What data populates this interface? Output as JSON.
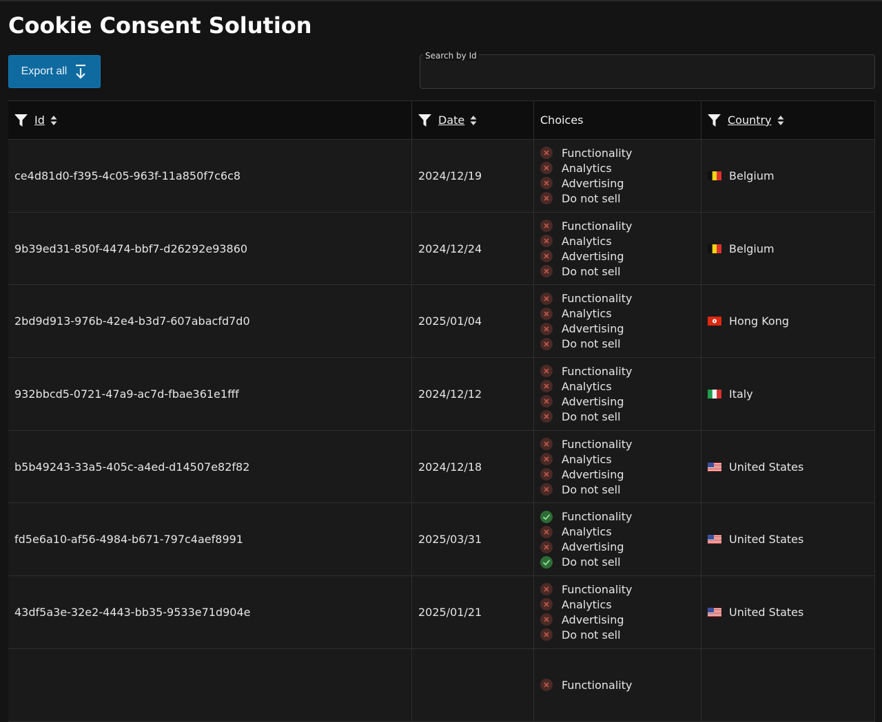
{
  "title": "Cookie Consent Solution",
  "toolbar": {
    "export_label": "Export all",
    "search_label": "Search by Id",
    "search_value": ""
  },
  "columns": {
    "id": "Id",
    "date": "Date",
    "choices": "Choices",
    "country": "Country"
  },
  "colors": {
    "accent": "#0f6aa0",
    "declined": "#4a2a26",
    "declined_mark": "#c0584d",
    "accepted": "#2e6b35",
    "accepted_mark": "#8fe09a"
  },
  "rows": [
    {
      "id": "ce4d81d0-f395-4c05-963f-11a850f7c6c8",
      "date": "2024/12/19",
      "country": "Belgium",
      "flag": "be",
      "choices": [
        {
          "label": "Functionality",
          "accepted": false
        },
        {
          "label": "Analytics",
          "accepted": false
        },
        {
          "label": "Advertising",
          "accepted": false
        },
        {
          "label": "Do not sell",
          "accepted": false
        }
      ]
    },
    {
      "id": "9b39ed31-850f-4474-bbf7-d26292e93860",
      "date": "2024/12/24",
      "country": "Belgium",
      "flag": "be",
      "choices": [
        {
          "label": "Functionality",
          "accepted": false
        },
        {
          "label": "Analytics",
          "accepted": false
        },
        {
          "label": "Advertising",
          "accepted": false
        },
        {
          "label": "Do not sell",
          "accepted": false
        }
      ]
    },
    {
      "id": "2bd9d913-976b-42e4-b3d7-607abacfd7d0",
      "date": "2025/01/04",
      "country": "Hong Kong",
      "flag": "hk",
      "choices": [
        {
          "label": "Functionality",
          "accepted": false
        },
        {
          "label": "Analytics",
          "accepted": false
        },
        {
          "label": "Advertising",
          "accepted": false
        },
        {
          "label": "Do not sell",
          "accepted": false
        }
      ]
    },
    {
      "id": "932bbcd5-0721-47a9-ac7d-fbae361e1fff",
      "date": "2024/12/12",
      "country": "Italy",
      "flag": "it",
      "choices": [
        {
          "label": "Functionality",
          "accepted": false
        },
        {
          "label": "Analytics",
          "accepted": false
        },
        {
          "label": "Advertising",
          "accepted": false
        },
        {
          "label": "Do not sell",
          "accepted": false
        }
      ]
    },
    {
      "id": "b5b49243-33a5-405c-a4ed-d14507e82f82",
      "date": "2024/12/18",
      "country": "United States",
      "flag": "us",
      "choices": [
        {
          "label": "Functionality",
          "accepted": false
        },
        {
          "label": "Analytics",
          "accepted": false
        },
        {
          "label": "Advertising",
          "accepted": false
        },
        {
          "label": "Do not sell",
          "accepted": false
        }
      ]
    },
    {
      "id": "fd5e6a10-af56-4984-b671-797c4aef8991",
      "date": "2025/03/31",
      "country": "United States",
      "flag": "us",
      "choices": [
        {
          "label": "Functionality",
          "accepted": true
        },
        {
          "label": "Analytics",
          "accepted": false
        },
        {
          "label": "Advertising",
          "accepted": false
        },
        {
          "label": "Do not sell",
          "accepted": true
        }
      ]
    },
    {
      "id": "43df5a3e-32e2-4443-bb35-9533e71d904e",
      "date": "2025/01/21",
      "country": "United States",
      "flag": "us",
      "choices": [
        {
          "label": "Functionality",
          "accepted": false
        },
        {
          "label": "Analytics",
          "accepted": false
        },
        {
          "label": "Advertising",
          "accepted": false
        },
        {
          "label": "Do not sell",
          "accepted": false
        }
      ]
    },
    {
      "id": "",
      "date": "",
      "country": "",
      "flag": "",
      "choices": [
        {
          "label": "Functionality",
          "accepted": false
        }
      ]
    }
  ]
}
